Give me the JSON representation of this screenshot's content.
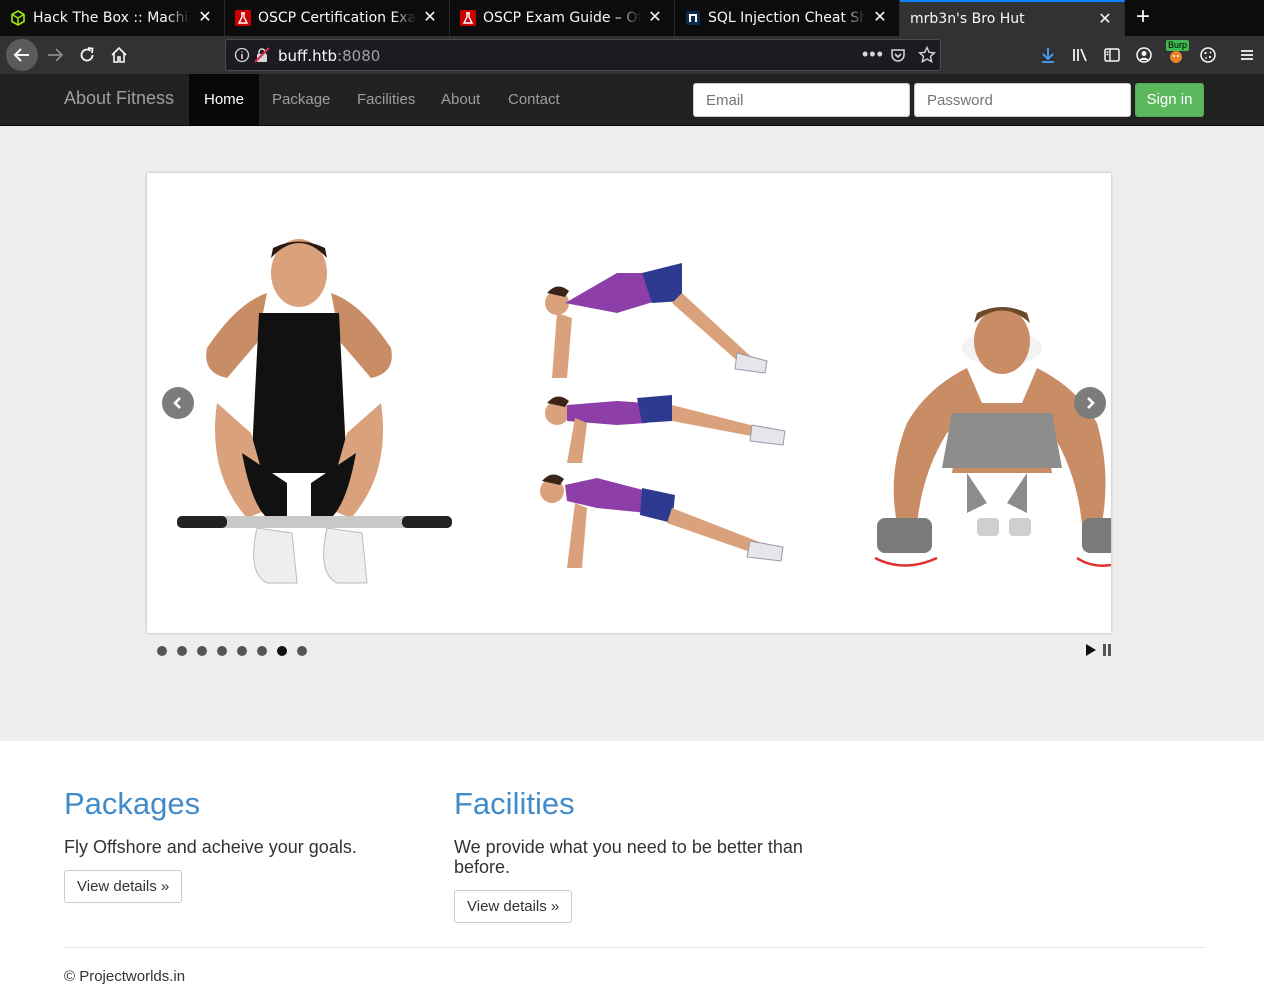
{
  "browser": {
    "tabs": [
      {
        "title": "Hack The Box :: Machines",
        "icon": "htb-cube-icon"
      },
      {
        "title": "OSCP Certification Exam",
        "icon": "offsec-flask-icon"
      },
      {
        "title": "OSCP Exam Guide – Offensive",
        "icon": "offsec-flask-icon"
      },
      {
        "title": "SQL Injection Cheat Sheet",
        "icon": "netsparker-icon"
      },
      {
        "title": "mrb3n's Bro Hut",
        "icon": ""
      }
    ],
    "url_host": "buff.htb",
    "url_port": ":8080",
    "extension_badge": "Burp"
  },
  "site": {
    "brand": "About Fitness",
    "nav": [
      "Home",
      "Package",
      "Facilities",
      "About",
      "Contact"
    ],
    "email_placeholder": "Email",
    "password_placeholder": "Password",
    "signin_label": "Sign in",
    "slider": {
      "dot_count": 8,
      "active_dot": 7
    },
    "packages": {
      "heading": "Packages",
      "text": "Fly Offshore and acheive your goals.",
      "button": "View details »"
    },
    "facilities": {
      "heading": "Facilities",
      "text": "We provide what you need to be better than before.",
      "button": "View details »"
    },
    "footer": "© Projectworlds.in"
  }
}
